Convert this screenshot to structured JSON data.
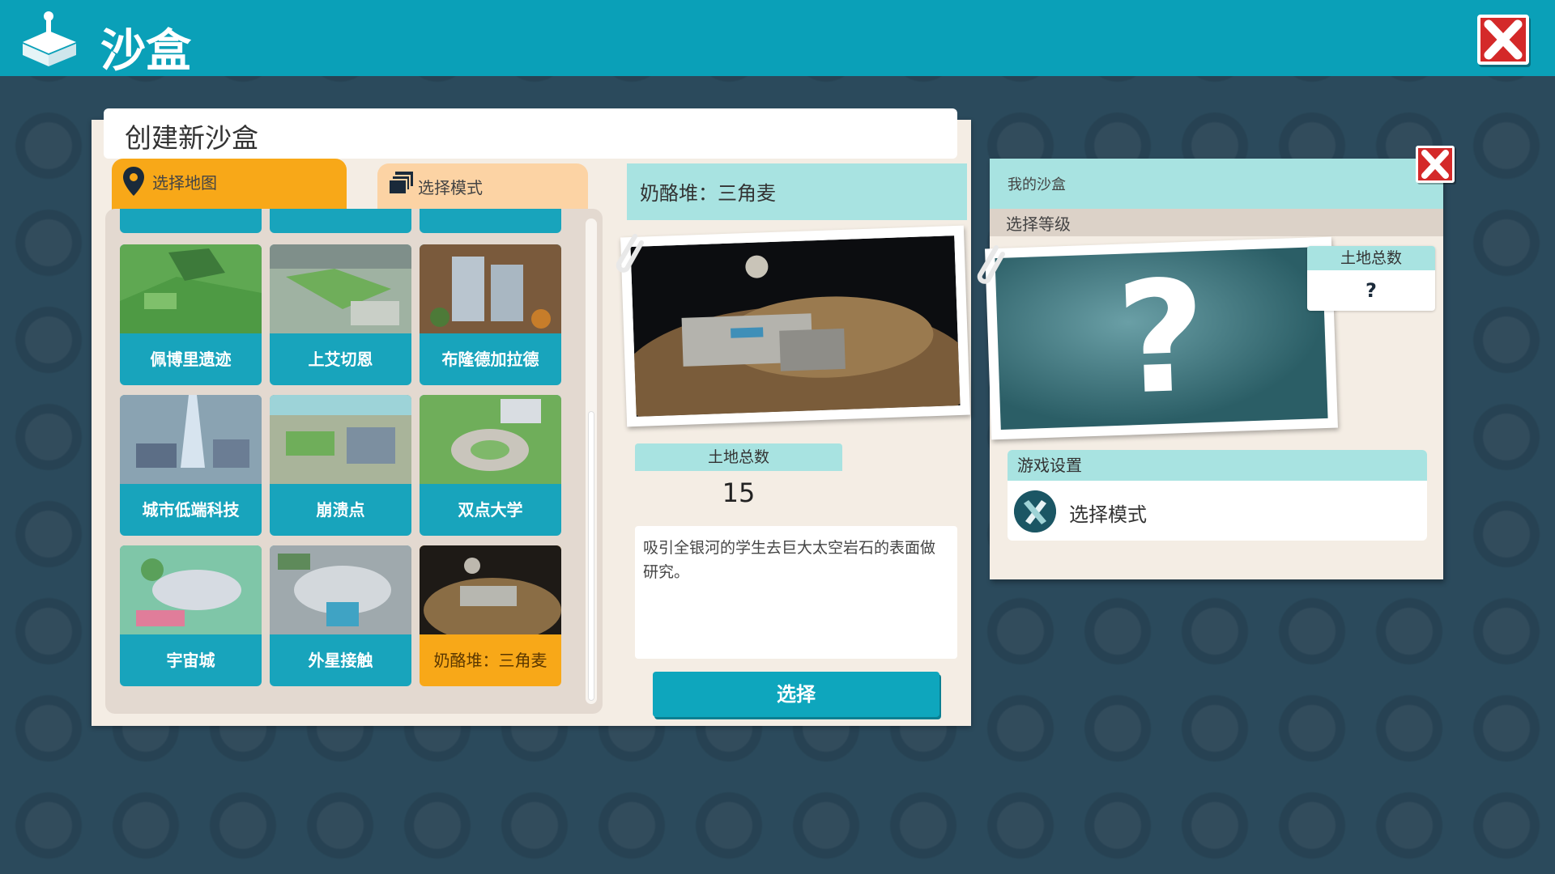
{
  "header": {
    "title": "沙盒",
    "logo_icon": "sandbox-joystick-icon",
    "close_icon": "close-icon"
  },
  "create": {
    "title": "创建新沙盒",
    "tabs": [
      {
        "label": "选择地图",
        "icon": "map-pin-icon",
        "active": true
      },
      {
        "label": "选择模式",
        "icon": "layers-icon",
        "active": false
      }
    ],
    "maps": [
      {
        "name": "佩博里遗迹",
        "selected": false
      },
      {
        "name": "上艾切恩",
        "selected": false
      },
      {
        "name": "布隆德加拉德",
        "selected": false
      },
      {
        "name": "城市低端科技",
        "selected": false
      },
      {
        "name": "崩溃点",
        "selected": false
      },
      {
        "name": "双点大学",
        "selected": false
      },
      {
        "name": "宇宙城",
        "selected": false
      },
      {
        "name": "外星接触",
        "selected": false
      },
      {
        "name": "奶酪堆：三角麦",
        "selected": true
      }
    ]
  },
  "detail": {
    "map_name": "奶酪堆：三角麦",
    "land_label": "土地总数",
    "land_value": "15",
    "description": "吸引全银河的学生去巨大太空岩石的表面做研究。",
    "select_button": "选择"
  },
  "my_sandbox": {
    "title": "我的沙盒",
    "level_label": "选择等级",
    "mystery_mark": "?",
    "land_label": "土地总数",
    "land_value": "?",
    "settings_label": "游戏设置",
    "mode_label": "选择模式",
    "mode_icon": "pencil-ruler-icon",
    "close_icon": "close-icon"
  },
  "colors": {
    "teal": "#0aa0b8",
    "orange": "#f8a818",
    "light_teal": "#a8e3e1",
    "red": "#d42929"
  }
}
